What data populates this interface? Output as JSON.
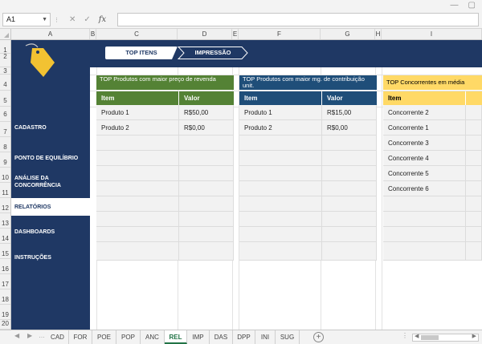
{
  "formula_bar": {
    "name_box": "A1",
    "fx_label": "fx",
    "cancel_icon": "close-icon",
    "enter_icon": "check-icon"
  },
  "columns": [
    "A",
    "B",
    "C",
    "D",
    "E",
    "F",
    "G",
    "H",
    "I"
  ],
  "rows": [
    "1",
    "2",
    "3",
    "4",
    "5",
    "6",
    "7",
    "8",
    "9",
    "10",
    "11",
    "12",
    "13",
    "14",
    "15",
    "16",
    "17",
    "18",
    "19",
    "20"
  ],
  "header_tabs": {
    "top_itens": "TOP ITENS",
    "impressao": "IMPRESSÃO"
  },
  "sidebar": {
    "items": [
      {
        "label": "CADASTRO"
      },
      {
        "label": "PONTO DE EQUILÍBRIO"
      },
      {
        "label": "ANÁLISE DA CONCORRÊNCIA"
      },
      {
        "label": "RELATÓRIOS"
      },
      {
        "label": "DASHBOARDS"
      },
      {
        "label": "INSTRUÇÕES"
      }
    ]
  },
  "panels": {
    "revenda": {
      "title": "TOP Produtos com maior preço de revenda",
      "col_item": "Item",
      "col_valor": "Valor",
      "rows": [
        {
          "item": "Produto 1",
          "valor": "R$50,00"
        },
        {
          "item": "Produto 2",
          "valor": "R$0,00"
        }
      ]
    },
    "contribuicao": {
      "title": "TOP Produtos com maior mg. de contribuição unit.",
      "col_item": "Item",
      "col_valor": "Valor",
      "rows": [
        {
          "item": "Produto 1",
          "valor": "R$15,00"
        },
        {
          "item": "Produto 2",
          "valor": "R$0,00"
        }
      ]
    },
    "concorrentes": {
      "title": "TOP Concorrentes em média",
      "col_item": "Item",
      "col_valor": "",
      "rows": [
        {
          "item": "Concorrente 2",
          "valor": ""
        },
        {
          "item": "Concorrente 1",
          "valor": ""
        },
        {
          "item": "Concorrente 3",
          "valor": ""
        },
        {
          "item": "Concorrente 4",
          "valor": ""
        },
        {
          "item": "Concorrente 5",
          "valor": ""
        },
        {
          "item": "Concorrente 6",
          "valor": ""
        }
      ]
    }
  },
  "sheet_tabs": [
    "CAD",
    "FOR",
    "POE",
    "POP",
    "ANC",
    "REL",
    "IMP",
    "DAS",
    "DPP",
    "INI",
    "SUG"
  ],
  "active_sheet": "REL",
  "colors": {
    "navy": "#1f3864",
    "green": "#548235",
    "blue": "#1f4e79",
    "yellow": "#ffd966",
    "tag": "#f2c232"
  }
}
